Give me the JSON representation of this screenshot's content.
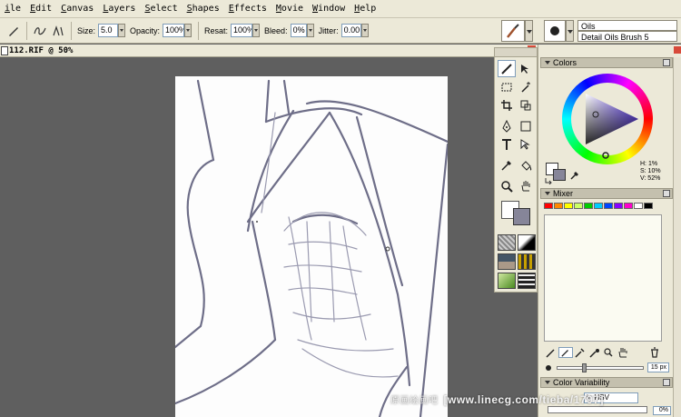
{
  "menu": [
    "ile",
    "Edit",
    "Canvas",
    "Layers",
    "Select",
    "Shapes",
    "Effects",
    "Movie",
    "Window",
    "Help"
  ],
  "property_bar": {
    "size_label": "Size:",
    "size_value": "5.0",
    "opacity_label": "Opacity:",
    "opacity_value": "100%",
    "resat_label": "Resat:",
    "resat_value": "100%",
    "bleed_label": "Bleed:",
    "bleed_value": "0%",
    "jitter_label": "Jitter:",
    "jitter_value": "0.00"
  },
  "brush_selector": {
    "category": "Oils",
    "variant": "Detail Oils Brush 5"
  },
  "document": {
    "title": "112.RIF @ 50%"
  },
  "panels": {
    "colors": {
      "title": "Colors",
      "h": "H: 1%",
      "s": "S: 10%",
      "v": "V: 52%",
      "main_color": "#ffffff",
      "secondary_color": "#868599"
    },
    "mixer": {
      "title": "Mixer",
      "swatches": [
        "#ff0000",
        "#ff8800",
        "#ffff00",
        "#ccff66",
        "#00cc00",
        "#00ccff",
        "#0044ff",
        "#8800ff",
        "#ff00cc",
        "#ffffff",
        "#000000"
      ],
      "brush_size": "15 px",
      "brush_fraction": 0.3
    },
    "color_variability": {
      "title": "Color Variability",
      "mode": "in HSV",
      "value": "0%"
    }
  },
  "watermark": {
    "cn_text": "原画绘画吧",
    "en_text": "[www.linecg.com/tieba/1797]"
  }
}
